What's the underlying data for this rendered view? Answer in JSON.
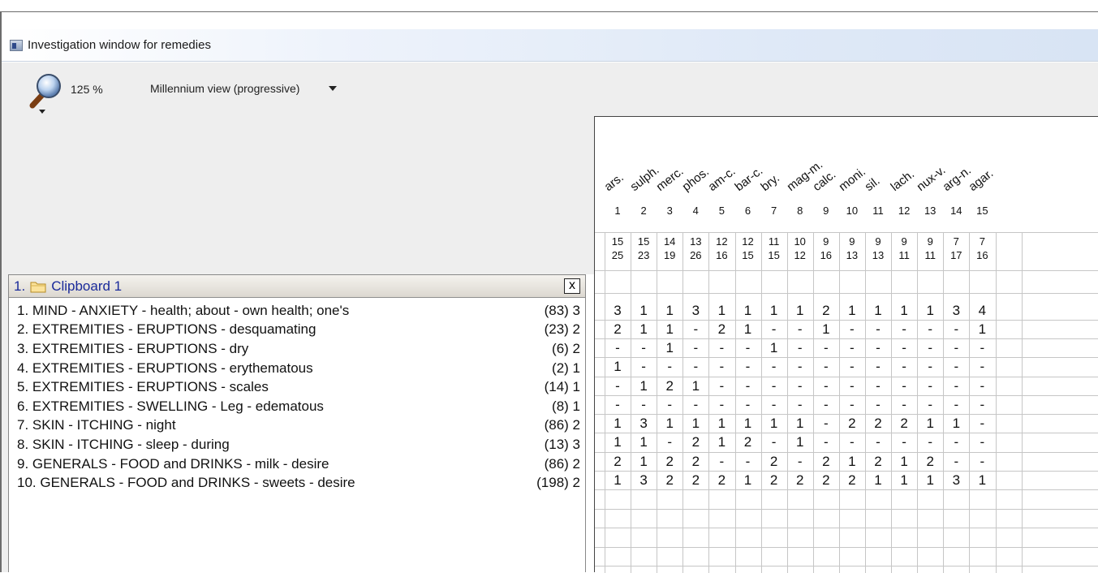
{
  "window": {
    "title": "Investigation window for remedies"
  },
  "toolbar": {
    "zoom": "125 %",
    "view_mode": "Millennium view (progressive)"
  },
  "clipboard": {
    "header": "1.",
    "name": "Clipboard 1",
    "close": "x",
    "rubrics": [
      {
        "text": "1. MIND - ANXIETY - health; about - own health; one's",
        "count": "(83) 3"
      },
      {
        "text": "2. EXTREMITIES - ERUPTIONS - desquamating",
        "count": "(23) 2"
      },
      {
        "text": "3. EXTREMITIES - ERUPTIONS - dry",
        "count": "(6) 2"
      },
      {
        "text": "4. EXTREMITIES - ERUPTIONS - erythematous",
        "count": "(2) 1"
      },
      {
        "text": "5. EXTREMITIES - ERUPTIONS - scales",
        "count": "(14) 1"
      },
      {
        "text": "6. EXTREMITIES - SWELLING - Leg - edematous",
        "count": "(8) 1"
      },
      {
        "text": "7. SKIN - ITCHING - night",
        "count": "(86) 2"
      },
      {
        "text": "8. SKIN - ITCHING - sleep - during",
        "count": "(13) 3"
      },
      {
        "text": "9. GENERALS - FOOD and DRINKS - milk - desire",
        "count": "(86) 2"
      },
      {
        "text": "10. GENERALS - FOOD and DRINKS - sweets - desire",
        "count": "(198) 2"
      }
    ]
  },
  "grid": {
    "remedies": [
      {
        "abbr": "ars.",
        "rank": "1",
        "score1": "15",
        "score2": "25"
      },
      {
        "abbr": "sulph.",
        "rank": "2",
        "score1": "15",
        "score2": "23"
      },
      {
        "abbr": "merc.",
        "rank": "3",
        "score1": "14",
        "score2": "19"
      },
      {
        "abbr": "phos.",
        "rank": "4",
        "score1": "13",
        "score2": "26"
      },
      {
        "abbr": "am-c.",
        "rank": "5",
        "score1": "12",
        "score2": "16"
      },
      {
        "abbr": "bar-c.",
        "rank": "6",
        "score1": "12",
        "score2": "15"
      },
      {
        "abbr": "bry.",
        "rank": "7",
        "score1": "11",
        "score2": "15"
      },
      {
        "abbr": "mag-m.",
        "rank": "8",
        "score1": "10",
        "score2": "12"
      },
      {
        "abbr": "calc.",
        "rank": "9",
        "score1": "9",
        "score2": "16"
      },
      {
        "abbr": "moni.",
        "rank": "10",
        "score1": "9",
        "score2": "13"
      },
      {
        "abbr": "sil.",
        "rank": "11",
        "score1": "9",
        "score2": "13"
      },
      {
        "abbr": "lach.",
        "rank": "12",
        "score1": "9",
        "score2": "11"
      },
      {
        "abbr": "nux-v.",
        "rank": "13",
        "score1": "9",
        "score2": "11"
      },
      {
        "abbr": "arg-n.",
        "rank": "14",
        "score1": "7",
        "score2": "17"
      },
      {
        "abbr": "agar.",
        "rank": "15",
        "score1": "7",
        "score2": "16"
      }
    ],
    "cells": [
      [
        "3",
        "1",
        "1",
        "3",
        "1",
        "1",
        "1",
        "1",
        "2",
        "1",
        "1",
        "1",
        "1",
        "3",
        "4"
      ],
      [
        "2",
        "1",
        "1",
        "-",
        "2",
        "1",
        "-",
        "-",
        "1",
        "-",
        "-",
        "-",
        "-",
        "-",
        "1"
      ],
      [
        "-",
        "-",
        "1",
        "-",
        "-",
        "-",
        "1",
        "-",
        "-",
        "-",
        "-",
        "-",
        "-",
        "-",
        "-"
      ],
      [
        "1",
        "-",
        "-",
        "-",
        "-",
        "-",
        "-",
        "-",
        "-",
        "-",
        "-",
        "-",
        "-",
        "-",
        "-"
      ],
      [
        "-",
        "1",
        "2",
        "1",
        "-",
        "-",
        "-",
        "-",
        "-",
        "-",
        "-",
        "-",
        "-",
        "-",
        "-"
      ],
      [
        "-",
        "-",
        "-",
        "-",
        "-",
        "-",
        "-",
        "-",
        "-",
        "-",
        "-",
        "-",
        "-",
        "-",
        "-"
      ],
      [
        "1",
        "3",
        "1",
        "1",
        "1",
        "1",
        "1",
        "1",
        "-",
        "2",
        "2",
        "2",
        "1",
        "1",
        "-"
      ],
      [
        "1",
        "1",
        "-",
        "2",
        "1",
        "2",
        "-",
        "1",
        "-",
        "-",
        "-",
        "-",
        "-",
        "-",
        "-"
      ],
      [
        "2",
        "1",
        "2",
        "2",
        "-",
        "-",
        "2",
        "-",
        "2",
        "1",
        "2",
        "1",
        "2",
        "-",
        "-"
      ],
      [
        "1",
        "3",
        "2",
        "2",
        "2",
        "1",
        "2",
        "2",
        "2",
        "2",
        "1",
        "1",
        "1",
        "3",
        "1"
      ]
    ]
  },
  "colors": {
    "clipboard_text": "#1a2a9a",
    "title_gradient": "#dfe9f7"
  }
}
